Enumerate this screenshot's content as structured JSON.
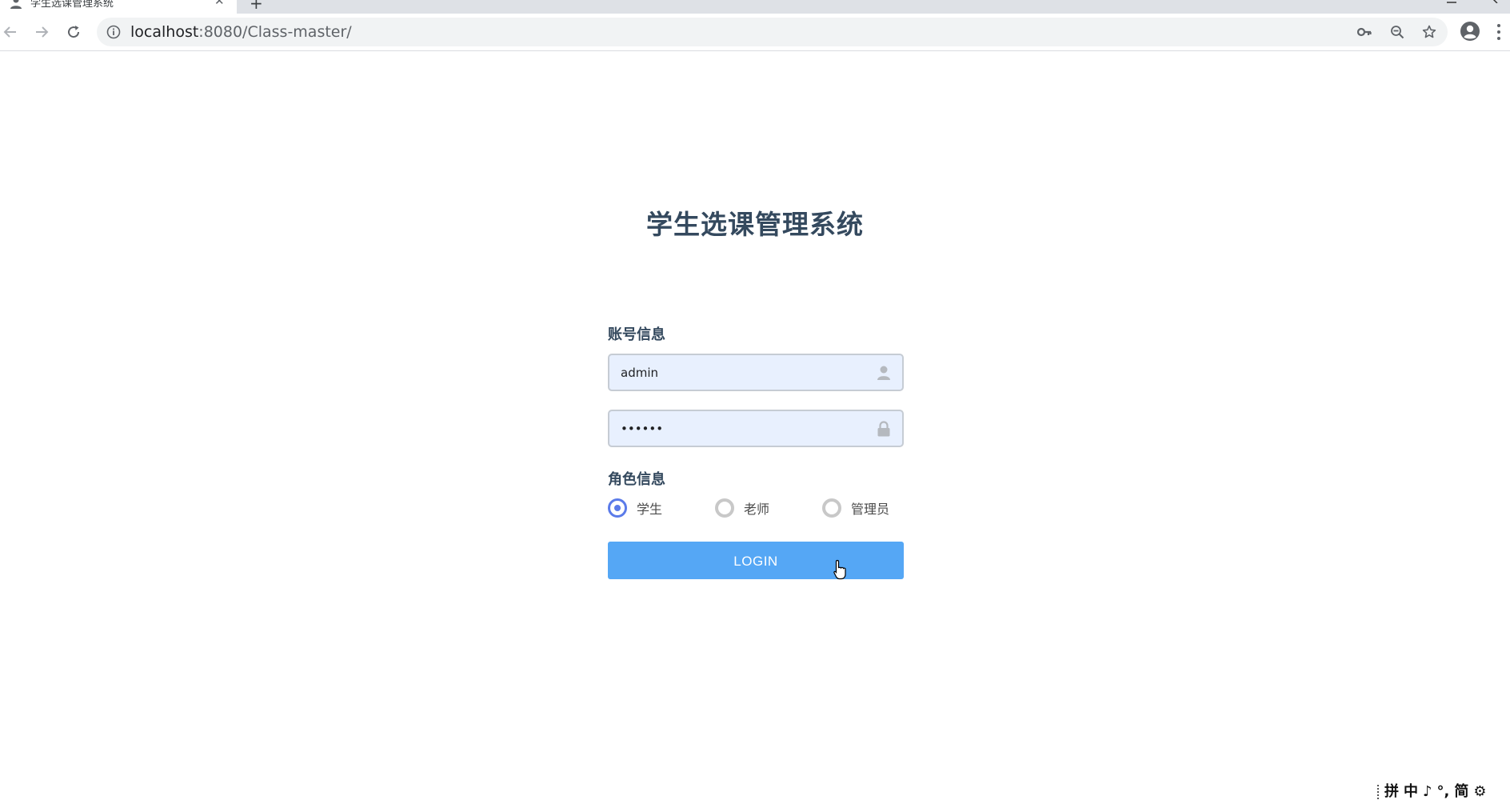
{
  "browser": {
    "tab_title": "学生选课管理系统",
    "new_tab_label": "+",
    "close_glyph": "✕",
    "url_host": "localhost",
    "url_rest": ":8080/Class-master/"
  },
  "page": {
    "title": "学生选课管理系统",
    "account_section_label": "账号信息",
    "username": {
      "value": "admin"
    },
    "password": {
      "value": "123456"
    },
    "role_section_label": "角色信息",
    "roles": [
      {
        "label": "学生",
        "checked": true
      },
      {
        "label": "老师",
        "checked": false
      },
      {
        "label": "管理员",
        "checked": false
      }
    ],
    "login_label": "LOGIN"
  },
  "ime": {
    "items": [
      "拼",
      "中",
      "♪",
      "°,",
      "简",
      "⚙"
    ]
  },
  "colors": {
    "title": "#34495e",
    "accent_button": "#55a7f5",
    "radio_checked": "#5b7be9",
    "field_bg": "#e8f0fe"
  }
}
